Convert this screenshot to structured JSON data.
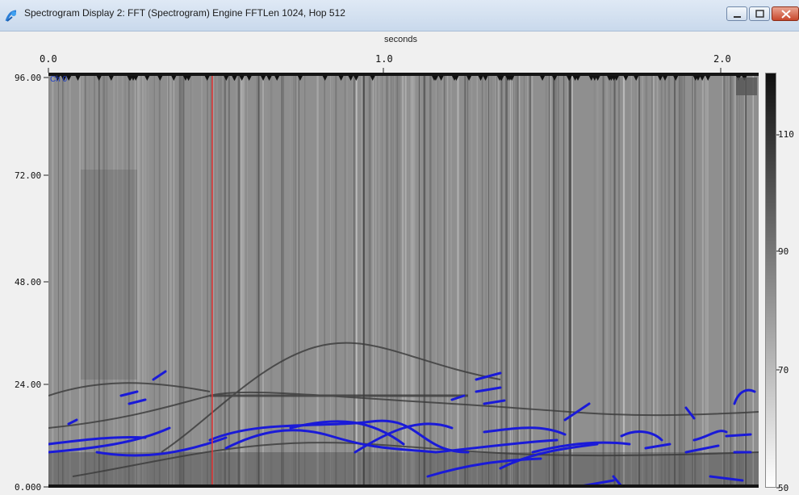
{
  "window": {
    "title": "Spectrogram Display 2: FFT (Spectrogram) Engine FFTLen 1024, Hop 512",
    "icon": "app-logo-icon"
  },
  "controls": {
    "minimize": "minimize-icon",
    "maximize": "maximize-icon",
    "close": "close-icon"
  },
  "plot": {
    "channel_label": "Ch 0",
    "x_axis_label": "seconds",
    "x_ticks": [
      "0.0",
      "1.0",
      "2.0"
    ],
    "y_ticks": [
      "96.00",
      "72.00",
      "48.00",
      "24.00",
      "0.000"
    ],
    "colorbar_ticks": [
      "110",
      "90",
      "70",
      "50"
    ],
    "cursor_color": "#e03030",
    "contour_color": "#1a1ad8",
    "background": "#8a8a8a"
  }
}
